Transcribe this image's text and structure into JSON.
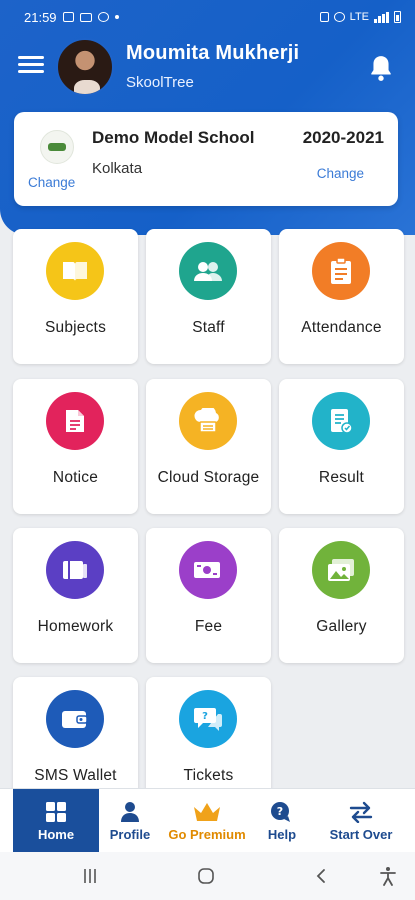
{
  "status_bar": {
    "time": "21:59",
    "network": "LTE"
  },
  "header": {
    "user_name": "Moumita Mukherji",
    "app_name": "SkoolTree"
  },
  "school": {
    "name": "Demo Model School",
    "year": "2020-2021",
    "city": "Kolkata",
    "change_label_left": "Change",
    "change_label_right": "Change"
  },
  "tiles": [
    {
      "label": "Subjects",
      "icon": "book-icon",
      "color": "#f5c518"
    },
    {
      "label": "Staff",
      "icon": "staff-icon",
      "color": "#1fa58e"
    },
    {
      "label": "Attendance",
      "icon": "clipboard-icon",
      "color": "#f27d26"
    },
    {
      "label": "Notice",
      "icon": "notice-icon",
      "color": "#e2235c"
    },
    {
      "label": "Cloud Storage",
      "icon": "cloud-icon",
      "color": "#f5b324"
    },
    {
      "label": "Result",
      "icon": "result-icon",
      "color": "#22b3c9"
    },
    {
      "label": "Homework",
      "icon": "homework-icon",
      "color": "#5b3fc4"
    },
    {
      "label": "Fee",
      "icon": "money-icon",
      "color": "#9b3fc9"
    },
    {
      "label": "Gallery",
      "icon": "gallery-icon",
      "color": "#71b33b"
    },
    {
      "label": "SMS Wallet",
      "icon": "wallet-icon",
      "color": "#1e5bb8"
    },
    {
      "label": "Tickets",
      "icon": "tickets-icon",
      "color": "#1aa4e0"
    }
  ],
  "bottom_nav": [
    {
      "label": "Home",
      "icon": "home-icon"
    },
    {
      "label": "Profile",
      "icon": "profile-icon"
    },
    {
      "label": "Go Premium",
      "icon": "crown-icon"
    },
    {
      "label": "Help",
      "icon": "help-icon"
    },
    {
      "label": "Start Over",
      "icon": "swap-icon"
    }
  ],
  "colors": {
    "primary": "#1d63c9",
    "nav_active": "#1a4f9c",
    "premium": "#e08a00",
    "link": "#3b7bd6"
  }
}
